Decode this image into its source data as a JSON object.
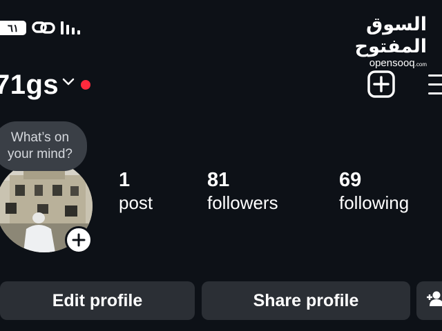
{
  "status_bar": {
    "battery_text": "٦١",
    "icons": [
      "battery-icon",
      "link-icon",
      "signal-icon"
    ]
  },
  "watermark": {
    "arabic": "السوق المفتوح",
    "latin": "opensooq",
    "latin_suffix": ".com"
  },
  "header": {
    "username": "71gs",
    "icons": [
      "chevron-down-icon",
      "notification-dot",
      "add-post-icon",
      "menu-icon"
    ],
    "dot_color": "#ff2a3d"
  },
  "profile": {
    "note_bubble_line1": "What’s on",
    "note_bubble_line2": "your mind?",
    "avatar_icon": "add-story-icon"
  },
  "stats": {
    "posts_count": "1",
    "posts_label": "post",
    "followers_count": "81",
    "followers_label": "followers",
    "following_count": "69",
    "following_label": "following"
  },
  "actions": {
    "edit_profile": "Edit profile",
    "share_profile": "Share profile",
    "discover_people_icon": "add-person-icon"
  },
  "colors": {
    "background": "#0d1117",
    "button_bg": "#2b2f35",
    "bubble_bg": "#3a3f46",
    "text": "#ffffff"
  }
}
